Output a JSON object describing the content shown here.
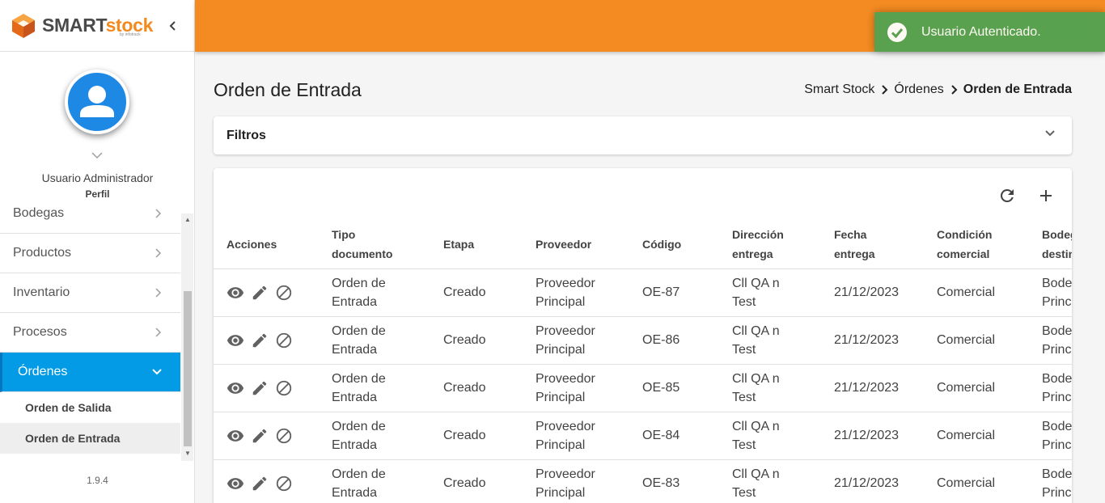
{
  "brand": {
    "smart": "SMART",
    "stock": "stock",
    "sub": "by infotrack"
  },
  "colors": {
    "topbar": "#f48b22",
    "active_menu": "#039be5",
    "toast": "#51a351",
    "avatar": "#1e88e5"
  },
  "user": {
    "name": "Usuario Administrador",
    "profile_link": "Perfil"
  },
  "sidebar": {
    "items": [
      {
        "label": "Bodegas",
        "icon": "chevron-right-icon"
      },
      {
        "label": "Productos",
        "icon": "chevron-right-icon"
      },
      {
        "label": "Inventario",
        "icon": "chevron-right-icon"
      },
      {
        "label": "Procesos",
        "icon": "chevron-right-icon"
      },
      {
        "label": "Órdenes",
        "icon": "chevron-down-icon",
        "active": true
      }
    ],
    "subitems": [
      {
        "label": "Orden de Salida"
      },
      {
        "label": "Orden de Entrada",
        "selected": true
      }
    ],
    "version": "1.9.4"
  },
  "toast": {
    "message": "Usuario Autenticado."
  },
  "page": {
    "title": "Orden de Entrada",
    "breadcrumb": [
      "Smart Stock",
      "Órdenes",
      "Orden de Entrada"
    ]
  },
  "filters": {
    "label": "Filtros"
  },
  "table": {
    "headers": {
      "actions": "Acciones",
      "type_a": "Tipo",
      "type_b": "documento",
      "stage": "Etapa",
      "supplier": "Proveedor",
      "code": "Código",
      "addr_a": "Dirección",
      "addr_b": "entrega",
      "date_a": "Fecha",
      "date_b": "entrega",
      "cond_a": "Condición",
      "cond_b": "comercial",
      "wh_a": "Bodega",
      "wh_b": "destino"
    },
    "rows": [
      {
        "type_a": "Orden de",
        "type_b": "Entrada",
        "stage": "Creado",
        "sup_a": "Proveedor",
        "sup_b": "Principal",
        "code": "OE-87",
        "addr_a": "Cll QA n",
        "addr_b": "Test",
        "date": "21/12/2023",
        "condition": "Comercial",
        "wh_a": "Bodega",
        "wh_b": "Principal"
      },
      {
        "type_a": "Orden de",
        "type_b": "Entrada",
        "stage": "Creado",
        "sup_a": "Proveedor",
        "sup_b": "Principal",
        "code": "OE-86",
        "addr_a": "Cll QA n",
        "addr_b": "Test",
        "date": "21/12/2023",
        "condition": "Comercial",
        "wh_a": "Bodega",
        "wh_b": "Principal"
      },
      {
        "type_a": "Orden de",
        "type_b": "Entrada",
        "stage": "Creado",
        "sup_a": "Proveedor",
        "sup_b": "Principal",
        "code": "OE-85",
        "addr_a": "Cll QA n",
        "addr_b": "Test",
        "date": "21/12/2023",
        "condition": "Comercial",
        "wh_a": "Bodega",
        "wh_b": "Principal"
      },
      {
        "type_a": "Orden de",
        "type_b": "Entrada",
        "stage": "Creado",
        "sup_a": "Proveedor",
        "sup_b": "Principal",
        "code": "OE-84",
        "addr_a": "Cll QA n",
        "addr_b": "Test",
        "date": "21/12/2023",
        "condition": "Comercial",
        "wh_a": "Bodega",
        "wh_b": "Principal"
      },
      {
        "type_a": "Orden de",
        "type_b": "Entrada",
        "stage": "Creado",
        "sup_a": "Proveedor",
        "sup_b": "Principal",
        "code": "OE-83",
        "addr_a": "Cll QA n",
        "addr_b": "Test",
        "date": "21/12/2023",
        "condition": "Comercial",
        "wh_a": "Bodega",
        "wh_b": "Principal"
      }
    ]
  }
}
